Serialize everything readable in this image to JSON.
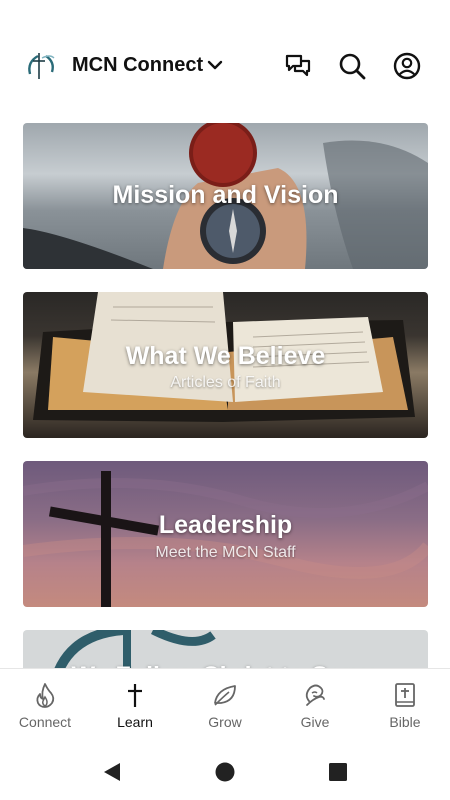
{
  "header": {
    "app_title": "MCN Connect"
  },
  "cards": [
    {
      "title": "Mission and Vision",
      "subtitle": ""
    },
    {
      "title": "What We Believe",
      "subtitle": "Articles of Faith"
    },
    {
      "title": "Leadership",
      "subtitle": "Meet the MCN Staff"
    },
    {
      "title": "We Follow Christ to Serve",
      "subtitle": ""
    }
  ],
  "bottom_nav": {
    "active": "Learn",
    "items": [
      {
        "label": "Connect",
        "icon": "flame-icon"
      },
      {
        "label": "Learn",
        "icon": "cross-icon"
      },
      {
        "label": "Grow",
        "icon": "leaf-icon"
      },
      {
        "label": "Give",
        "icon": "give-icon"
      },
      {
        "label": "Bible",
        "icon": "bible-icon"
      }
    ]
  },
  "colors": {
    "active_nav": "#111111",
    "inactive_nav": "#666666"
  }
}
